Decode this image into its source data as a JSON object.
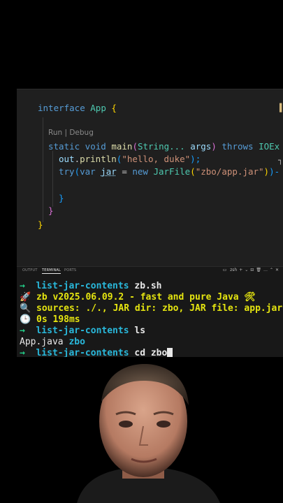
{
  "editor": {
    "line_interface": {
      "kw": "interface",
      "name": "App",
      "brace": "{"
    },
    "codelens": "Run | Debug",
    "line_main": {
      "mods": "static void",
      "name": "main",
      "open": "(",
      "ptype": "String...",
      "pname": "args",
      "close": ")",
      "throws": "throws",
      "exc": "IOEx"
    },
    "line_println": {
      "obj": "out",
      "dot": ".",
      "fn": "println",
      "open": "(",
      "str": "\"hello, duke\"",
      "close": ");"
    },
    "line_try": {
      "kw": "try",
      "open": "(",
      "var": "var",
      "name": "jar",
      "eq": " = ",
      "new": "new",
      "type": "JarFile",
      "p": "(",
      "str": "\"zbo/app.jar\"",
      "pc": ")",
      "rest": ")-"
    },
    "close_inner": "}",
    "close_main": "}",
    "close_iface": "}"
  },
  "panel": {
    "tabs": [
      "OUTPUT",
      "TERMINAL",
      "PORTS"
    ],
    "active_tab": "TERMINAL",
    "shell_label": "zsh",
    "actions": [
      "+",
      "⌄",
      "⊟",
      "🗑",
      "…",
      "⌃",
      "✕"
    ]
  },
  "terminal": {
    "lines": [
      {
        "prefix": "→",
        "dir": "list-jar-contents",
        "cmd": "zb.sh"
      },
      {
        "icon": "🚀",
        "text": "zb v2025.06.09.2 - fast and pure Java 🛠"
      },
      {
        "icon": "🔍",
        "text": "sources: ./., JAR dir: zbo, JAR file: app.jar"
      },
      {
        "icon": "🕒",
        "text": "0s 198ms"
      },
      {
        "prefix": "→",
        "dir": "list-jar-contents",
        "cmd": "ls"
      },
      {
        "out1": "App.java",
        "out2": "zbo"
      },
      {
        "prefix": "→",
        "dir": "list-jar-contents",
        "cmd": "cd zbo"
      }
    ]
  }
}
